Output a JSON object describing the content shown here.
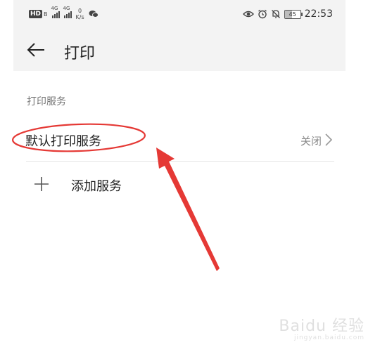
{
  "status_bar": {
    "hd_badge": "HD",
    "signal_1_label": "4G",
    "signal_2_label": "4G",
    "net_speed_value": "0",
    "net_speed_unit": "K/s",
    "battery": "45",
    "time": "22:53",
    "icons": [
      "wechat-icon",
      "eye-icon",
      "alarm-icon",
      "mute-icon"
    ]
  },
  "app_bar": {
    "title": "打印"
  },
  "section": {
    "label": "打印服务"
  },
  "service_row": {
    "label": "默认打印服务",
    "value": "关闭"
  },
  "add_row": {
    "label": "添加服务"
  },
  "annotation": {
    "color": "#e53935"
  },
  "watermark": {
    "text": "Baidu 经验",
    "url": "jingyan.baidu.com"
  }
}
